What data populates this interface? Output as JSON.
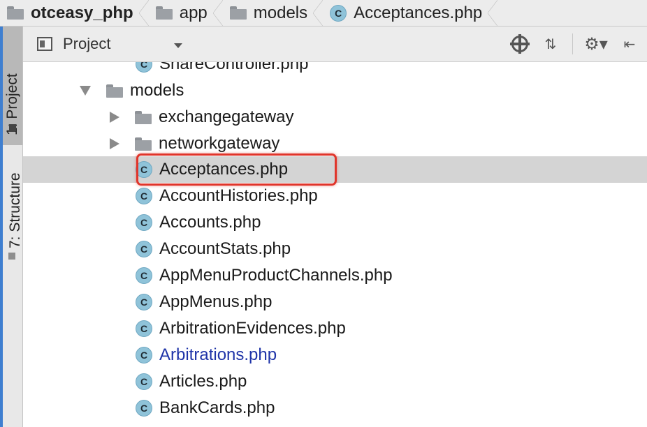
{
  "breadcrumb": [
    {
      "label": "otceasy_php",
      "icon": "folder-icon"
    },
    {
      "label": "app",
      "icon": "folder-icon"
    },
    {
      "label": "models",
      "icon": "folder-icon"
    },
    {
      "label": "Acceptances.php",
      "icon": "php-class-icon"
    }
  ],
  "tool_windows": {
    "project": "1: Project",
    "structure": "7: Structure"
  },
  "project_panel": {
    "view_mode": "Project",
    "buttons": [
      "locate-icon",
      "collapse-all-icon",
      "settings-icon",
      "hide-icon"
    ]
  },
  "tree": {
    "class_glyph": "C",
    "items": [
      {
        "label": "ShareController.php",
        "kind": "file"
      },
      {
        "label": "models",
        "kind": "folder",
        "expanded": true
      },
      {
        "label": "exchangegateway",
        "kind": "folder",
        "expanded": false
      },
      {
        "label": "networkgateway",
        "kind": "folder",
        "expanded": false
      },
      {
        "label": "Acceptances.php",
        "kind": "file",
        "selected": true,
        "highlighted": true
      },
      {
        "label": "AccountHistories.php",
        "kind": "file"
      },
      {
        "label": "Accounts.php",
        "kind": "file"
      },
      {
        "label": "AccountStats.php",
        "kind": "file"
      },
      {
        "label": "AppMenuProductChannels.php",
        "kind": "file"
      },
      {
        "label": "AppMenus.php",
        "kind": "file"
      },
      {
        "label": "ArbitrationEvidences.php",
        "kind": "file"
      },
      {
        "label": "Arbitrations.php",
        "kind": "file",
        "status": "modified"
      },
      {
        "label": "Articles.php",
        "kind": "file"
      },
      {
        "label": "BankCards.php",
        "kind": "file"
      }
    ]
  },
  "colors": {
    "accent": "#3f7fd0",
    "selection": "#d4d4d4",
    "highlight_border": "#e0352b",
    "modified_text": "#1f34a8",
    "class_icon": "#8fc3d9"
  }
}
